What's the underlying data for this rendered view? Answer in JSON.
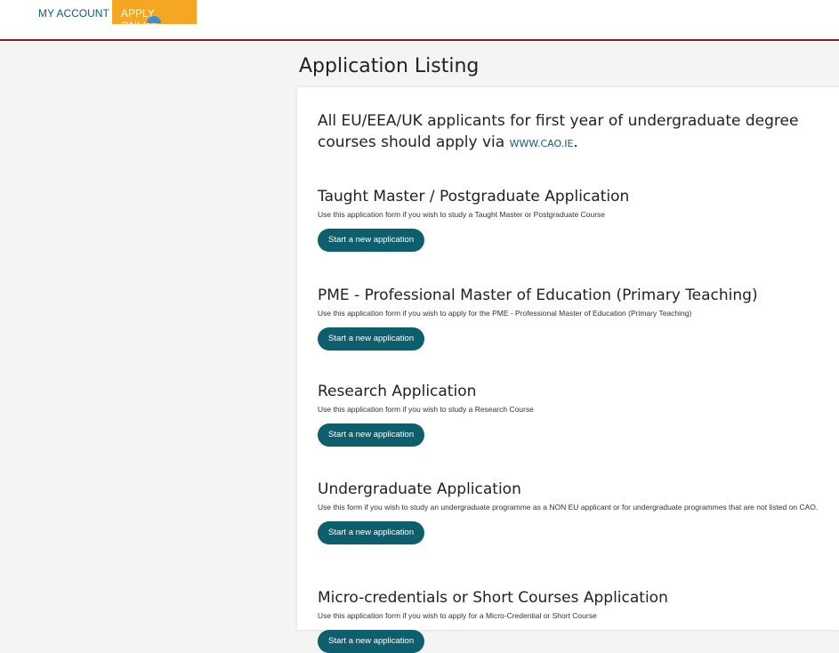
{
  "nav": {
    "my_account": "MY ACCOUNT",
    "apply_online": "APPLY ONLINE"
  },
  "colors": {
    "accent_teal": "#0e5f6e",
    "active_tab": "#f5a623",
    "divider": "#8b1c1c",
    "indicator_dot": "#3a8fd6"
  },
  "main": {
    "title": "Application Listing",
    "intro_text": "All EU/EEA/UK applicants for first year of undergraduate degree courses should apply via ",
    "intro_link": "WWW.CAO.IE",
    "intro_end": "."
  },
  "sections": [
    {
      "title": "Taught Master / Postgraduate Application",
      "description": "Use this application form if you wish to study a Taught Master or Postgraduate Course",
      "button": "Start a new application"
    },
    {
      "title": "PME - Professional Master of Education (Primary Teaching)",
      "description": "Use this application form if you wish to apply for the PME - Professional Master of Education (Primary Teaching)",
      "button": "Start a new application"
    },
    {
      "title": "Research Application",
      "description": "Use this application form if you wish to study a Research Course",
      "button": "Start a new application"
    },
    {
      "title": "Undergraduate Application",
      "description": "Use this form if you wish to study an undergraduate programme as a NON EU applicant or for undergraduate programmes that are not listed on CAO.",
      "button": "Start a new application"
    },
    {
      "title": "Micro-credentials or Short Courses Application",
      "description": "Use this application form if you wish to apply for a Micro-Credential or Short Course",
      "button": "Start a new application"
    }
  ]
}
